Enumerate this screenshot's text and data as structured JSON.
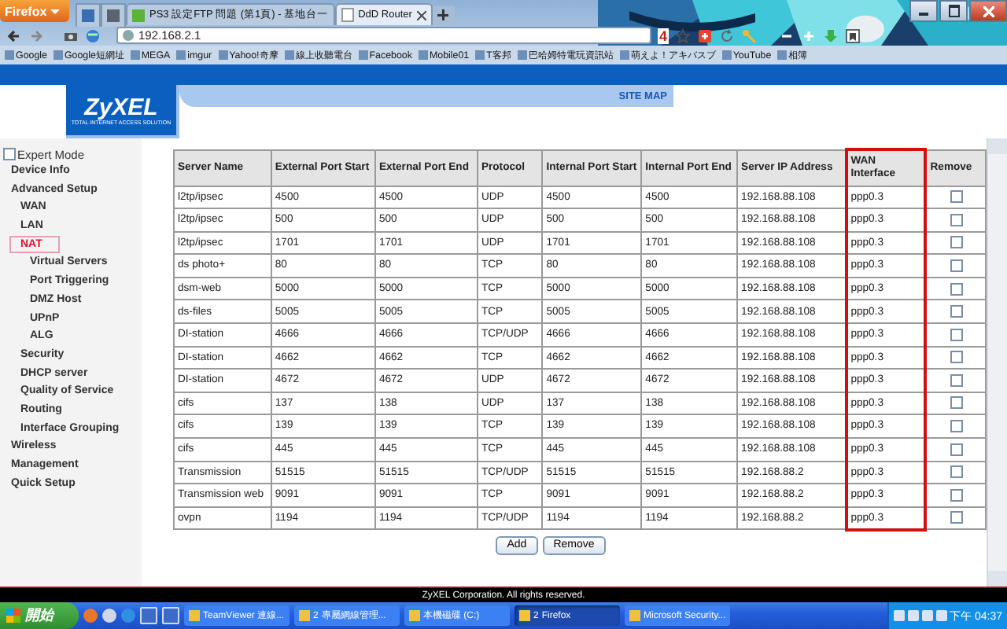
{
  "browser": {
    "menu_button": "Firefox",
    "tabs": [
      {
        "title": "PS3 設定FTP 問題 (第1頁) - 基地台一",
        "selected": false
      },
      {
        "title": "DdD Router",
        "selected": true
      }
    ],
    "address": "192.168.2.1",
    "badge": "4",
    "bookmarks": [
      "Google",
      "Google短網址",
      "MEGA",
      "imgur",
      "Yahoo!奇摩",
      "線上收聽電台",
      "Facebook",
      "Mobile01",
      "T客邦",
      "巴哈姆特電玩資訊站",
      "萌えよ！アキバスブ",
      "YouTube",
      "相簿"
    ]
  },
  "page": {
    "logo": "ZyXEL",
    "tagline": "TOTAL INTERNET ACCESS SOLUTION",
    "site_map": "SITE MAP",
    "expert_mode": {
      "label": "Expert Mode",
      "checked": false
    },
    "nav": [
      {
        "label": "Device Info",
        "selected": false
      },
      {
        "label": "Advanced Setup",
        "selected": false,
        "children": [
          {
            "label": "WAN",
            "selected": false
          },
          {
            "label": "LAN",
            "selected": false
          },
          {
            "label": "NAT",
            "selected": true,
            "children": [
              {
                "label": "Virtual Servers",
                "selected": false
              },
              {
                "label": "Port Triggering",
                "selected": false
              },
              {
                "label": "DMZ Host",
                "selected": false
              },
              {
                "label": "UPnP",
                "selected": false
              },
              {
                "label": "ALG",
                "selected": false
              }
            ]
          },
          {
            "label": "Security",
            "selected": false
          },
          {
            "label": "DHCP server",
            "selected": false
          },
          {
            "label": "Quality of Service",
            "selected": false
          },
          {
            "label": "Routing",
            "selected": false
          },
          {
            "label": "Interface Grouping",
            "selected": false
          }
        ]
      },
      {
        "label": "Wireless",
        "selected": false
      },
      {
        "label": "Management",
        "selected": false
      },
      {
        "label": "Quick Setup",
        "selected": false
      }
    ],
    "table": {
      "columns": [
        {
          "label": "Server Name",
          "highlighted": false
        },
        {
          "label": "External Port Start",
          "highlighted": false
        },
        {
          "label": "External Port End",
          "highlighted": false
        },
        {
          "label": "Protocol",
          "highlighted": false
        },
        {
          "label": "Internal Port Start",
          "highlighted": false
        },
        {
          "label": "Internal Port End",
          "highlighted": false
        },
        {
          "label": "Server IP Address",
          "highlighted": false
        },
        {
          "label": "WAN Interface",
          "highlighted": true
        },
        {
          "label": "Remove",
          "highlighted": false
        }
      ],
      "rows": [
        {
          "cells": [
            "l2tp/ipsec",
            "4500",
            "4500",
            "UDP",
            "4500",
            "4500",
            "192.168.88.108",
            "ppp0.3"
          ],
          "remove": false
        },
        {
          "cells": [
            "l2tp/ipsec",
            "500",
            "500",
            "UDP",
            "500",
            "500",
            "192.168.88.108",
            "ppp0.3"
          ],
          "remove": false
        },
        {
          "cells": [
            "l2tp/ipsec",
            "1701",
            "1701",
            "UDP",
            "1701",
            "1701",
            "192.168.88.108",
            "ppp0.3"
          ],
          "remove": false
        },
        {
          "cells": [
            "ds photo+",
            "80",
            "80",
            "TCP",
            "80",
            "80",
            "192.168.88.108",
            "ppp0.3"
          ],
          "remove": false
        },
        {
          "cells": [
            "dsm-web",
            "5000",
            "5000",
            "TCP",
            "5000",
            "5000",
            "192.168.88.108",
            "ppp0.3"
          ],
          "remove": false
        },
        {
          "cells": [
            "ds-files",
            "5005",
            "5005",
            "TCP",
            "5005",
            "5005",
            "192.168.88.108",
            "ppp0.3"
          ],
          "remove": false
        },
        {
          "cells": [
            "DI-station",
            "4666",
            "4666",
            "TCP/UDP",
            "4666",
            "4666",
            "192.168.88.108",
            "ppp0.3"
          ],
          "remove": false
        },
        {
          "cells": [
            "DI-station",
            "4662",
            "4662",
            "TCP",
            "4662",
            "4662",
            "192.168.88.108",
            "ppp0.3"
          ],
          "remove": false
        },
        {
          "cells": [
            "DI-station",
            "4672",
            "4672",
            "UDP",
            "4672",
            "4672",
            "192.168.88.108",
            "ppp0.3"
          ],
          "remove": false
        },
        {
          "cells": [
            "cifs",
            "137",
            "138",
            "UDP",
            "137",
            "138",
            "192.168.88.108",
            "ppp0.3"
          ],
          "remove": false
        },
        {
          "cells": [
            "cifs",
            "139",
            "139",
            "TCP",
            "139",
            "139",
            "192.168.88.108",
            "ppp0.3"
          ],
          "remove": false
        },
        {
          "cells": [
            "cifs",
            "445",
            "445",
            "TCP",
            "445",
            "445",
            "192.168.88.108",
            "ppp0.3"
          ],
          "remove": false
        },
        {
          "cells": [
            "Transmission",
            "51515",
            "51515",
            "TCP/UDP",
            "51515",
            "51515",
            "192.168.88.2",
            "ppp0.3"
          ],
          "remove": false
        },
        {
          "cells": [
            "Transmission web",
            "9091",
            "9091",
            "TCP",
            "9091",
            "9091",
            "192.168.88.2",
            "ppp0.3"
          ],
          "remove": false
        },
        {
          "cells": [
            "ovpn",
            "1194",
            "1194",
            "TCP/UDP",
            "1194",
            "1194",
            "192.168.88.2",
            "ppp0.3"
          ],
          "remove": false
        }
      ]
    },
    "buttons": [
      "Add",
      "Remove"
    ],
    "footer": "ZyXEL Corporation. All rights reserved."
  },
  "taskbar": {
    "start": "開始",
    "tasks": [
      {
        "label": "TeamViewer 連線...",
        "selected": false
      },
      {
        "label": "專屬網線管理...",
        "count": "2",
        "selected": false
      },
      {
        "label": "本機磁碟 (C:)",
        "selected": false
      },
      {
        "label": "Firefox",
        "count": "2",
        "selected": true
      },
      {
        "label": "Microsoft Security...",
        "selected": false
      }
    ],
    "clock": "下午 04:37"
  }
}
